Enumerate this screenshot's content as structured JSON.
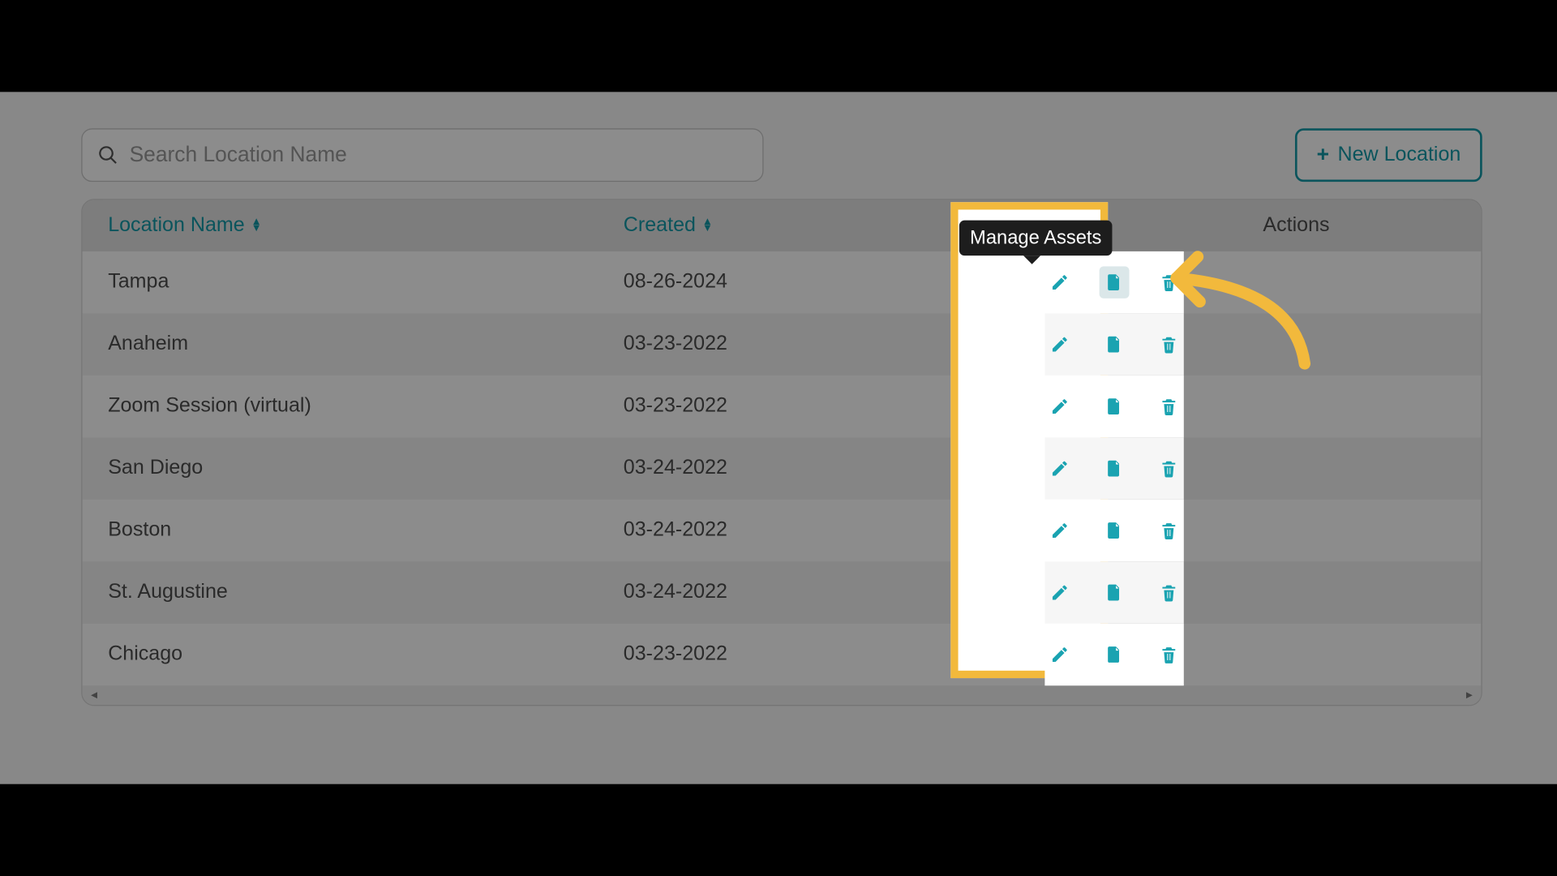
{
  "search": {
    "placeholder": "Search Location Name"
  },
  "newButton": {
    "label": "New Location"
  },
  "columns": {
    "name": "Location Name",
    "created": "Created",
    "actions": "Actions"
  },
  "tooltip": "Manage Assets",
  "rows": [
    {
      "name": "Tampa",
      "created": "08-26-2024"
    },
    {
      "name": "Anaheim",
      "created": "03-23-2022"
    },
    {
      "name": "Zoom Session (virtual)",
      "created": "03-23-2022"
    },
    {
      "name": "San Diego",
      "created": "03-24-2022"
    },
    {
      "name": "Boston",
      "created": "03-24-2022"
    },
    {
      "name": "St. Augustine",
      "created": "03-24-2022"
    },
    {
      "name": "Chicago",
      "created": "03-23-2022"
    }
  ]
}
